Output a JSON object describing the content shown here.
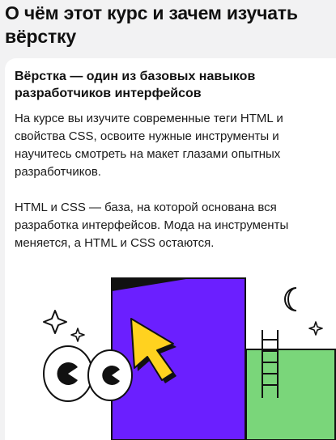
{
  "page": {
    "title": "О чём этот курс и зачем изучать вёрстку"
  },
  "card": {
    "title": "Вёрстка — один из базовых навыков разработчиков интерфейсов",
    "paragraph_1": "На курсе вы изучите современные теги HTML и свойства CSS, освоите нужные инструменты и научитесь смотреть на макет глазами опытных разработчиков.",
    "paragraph_2": "HTML и CSS — база, на которой основана вся разработка интерфейсов. Мода на инструменты меняется, а HTML и CSS остаются."
  },
  "illustration": {
    "icons": [
      "eyes-icon",
      "cursor-arrow-icon",
      "sparkle-icon",
      "moon-icon",
      "ladder-icon"
    ],
    "colors": {
      "purple": "#6b1fff",
      "yellow": "#ffd21f",
      "green": "#7ad67a",
      "black": "#111111"
    }
  }
}
